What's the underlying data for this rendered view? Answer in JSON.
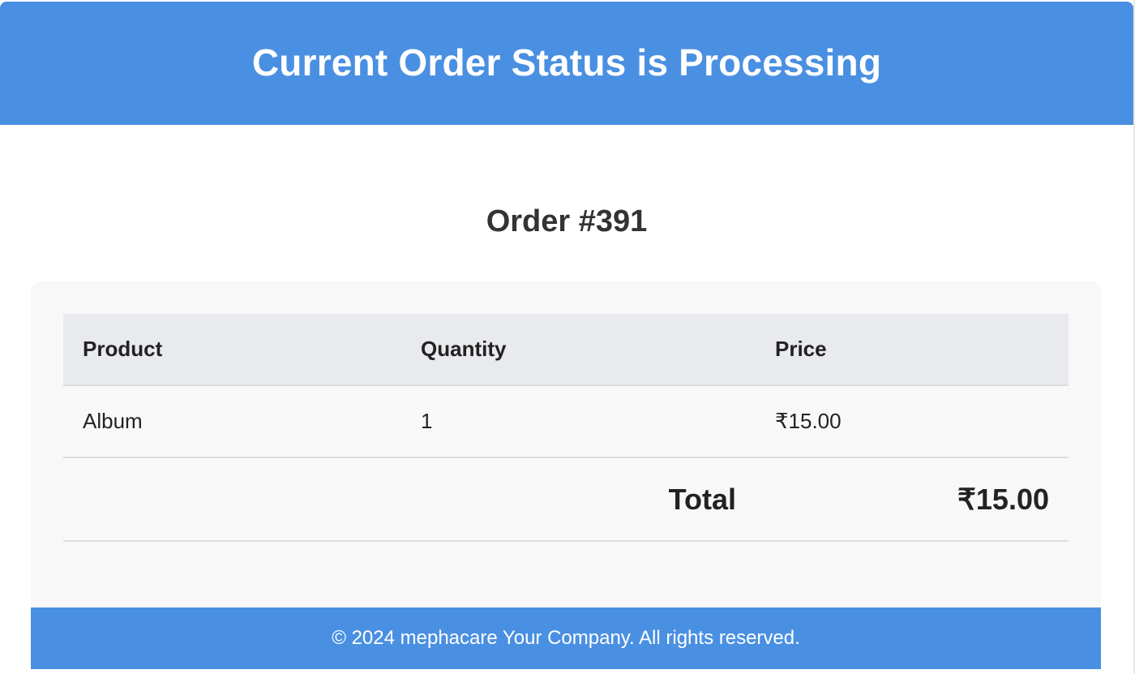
{
  "header": {
    "title": "Current Order Status is Processing"
  },
  "order": {
    "title": "Order #391"
  },
  "table": {
    "columns": [
      "Product",
      "Quantity",
      "Price"
    ],
    "rows": [
      {
        "product": "Album",
        "quantity": "1",
        "price": "₹15.00"
      }
    ],
    "total_label": "Total",
    "total_value": "₹15.00"
  },
  "footer": {
    "text": "© 2024 mephacare Your Company. All rights reserved."
  },
  "colors": {
    "brand": "#4a90e2",
    "card_background": "#f8f8f8",
    "table_header_background": "#e8eaed"
  }
}
